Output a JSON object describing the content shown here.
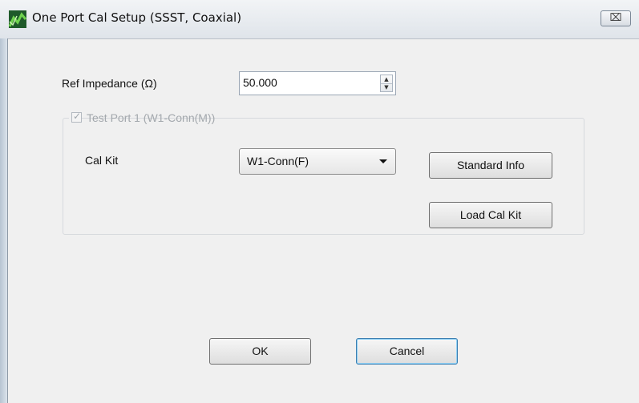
{
  "window": {
    "title": "One Port Cal Setup (SSST, Coaxial)",
    "icon": "app-icon",
    "close_icon": "close-icon",
    "close_glyph": "⌧"
  },
  "ref_impedance": {
    "label": "Ref Impedance (Ω)",
    "value": "50.000",
    "spin_up_glyph": "▲",
    "spin_down_glyph": "▼"
  },
  "test_port": {
    "label": "Test Port 1 (W1-Conn(M))",
    "checked": true,
    "enabled": false,
    "check_glyph": "✓",
    "cal_kit_label": "Cal Kit",
    "cal_kit_value": "W1-Conn(F)",
    "standard_info_label": "Standard Info",
    "load_cal_kit_label": "Load Cal Kit"
  },
  "footer": {
    "ok_label": "OK",
    "cancel_label": "Cancel"
  },
  "colors": {
    "title_bar": "#e6eaee",
    "client": "#f0f0f0",
    "disabled_text": "#a3a8ad",
    "default_button_border": "#3c7fb1"
  }
}
